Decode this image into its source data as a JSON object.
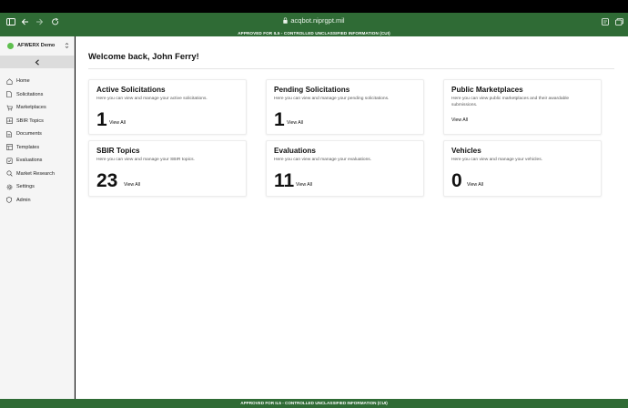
{
  "browser": {
    "url": "acqbot.niprgpt.mil"
  },
  "banner": {
    "top": "APPROVED FOR IL5 - CONTROLLED UNCLASSIFIED INFORMATION (CUI)",
    "bottom": "APPROVED FOR IL5 - CONTROLLED UNCLASSIFIED INFORMATION (CUI)"
  },
  "sidebar": {
    "org_name": "AFWERX Demo",
    "items": [
      {
        "label": "Home",
        "icon": "home-icon"
      },
      {
        "label": "Solicitations",
        "icon": "document-icon"
      },
      {
        "label": "Marketplaces",
        "icon": "cart-icon"
      },
      {
        "label": "SBIR Topics",
        "icon": "chart-icon"
      },
      {
        "label": "Documents",
        "icon": "file-icon"
      },
      {
        "label": "Templates",
        "icon": "template-icon"
      },
      {
        "label": "Evaluations",
        "icon": "checklist-icon"
      },
      {
        "label": "Market Research",
        "icon": "search-icon"
      },
      {
        "label": "Settings",
        "icon": "gear-icon"
      },
      {
        "label": "Admin",
        "icon": "shield-icon"
      }
    ]
  },
  "main": {
    "welcome": "Welcome back, John Ferry!",
    "cards": [
      {
        "title": "Active Solicitations",
        "desc": "Here you can view and manage your active solicitations.",
        "count": "1",
        "link": "View All"
      },
      {
        "title": "Pending Solicitations",
        "desc": "Here you can view and manage your pending solicitations.",
        "count": "1",
        "link": "View All"
      },
      {
        "title": "Public Marketplaces",
        "desc": "Here you can view public marketplaces and their awardable submissions.",
        "count": "",
        "link": "View All"
      },
      {
        "title": "SBIR Topics",
        "desc": "Here you can view and manage your SBIR topics.",
        "count": "23",
        "link": "View All"
      },
      {
        "title": "Evaluations",
        "desc": "Here you can view and manage your evaluations.",
        "count": "11",
        "link": "View All"
      },
      {
        "title": "Vehicles",
        "desc": "Here you can view and manage your vehicles.",
        "count": "0",
        "link": "View All"
      }
    ]
  },
  "colors": {
    "banner_green": "#2f6b35",
    "org_dot": "#5fbf4f"
  }
}
